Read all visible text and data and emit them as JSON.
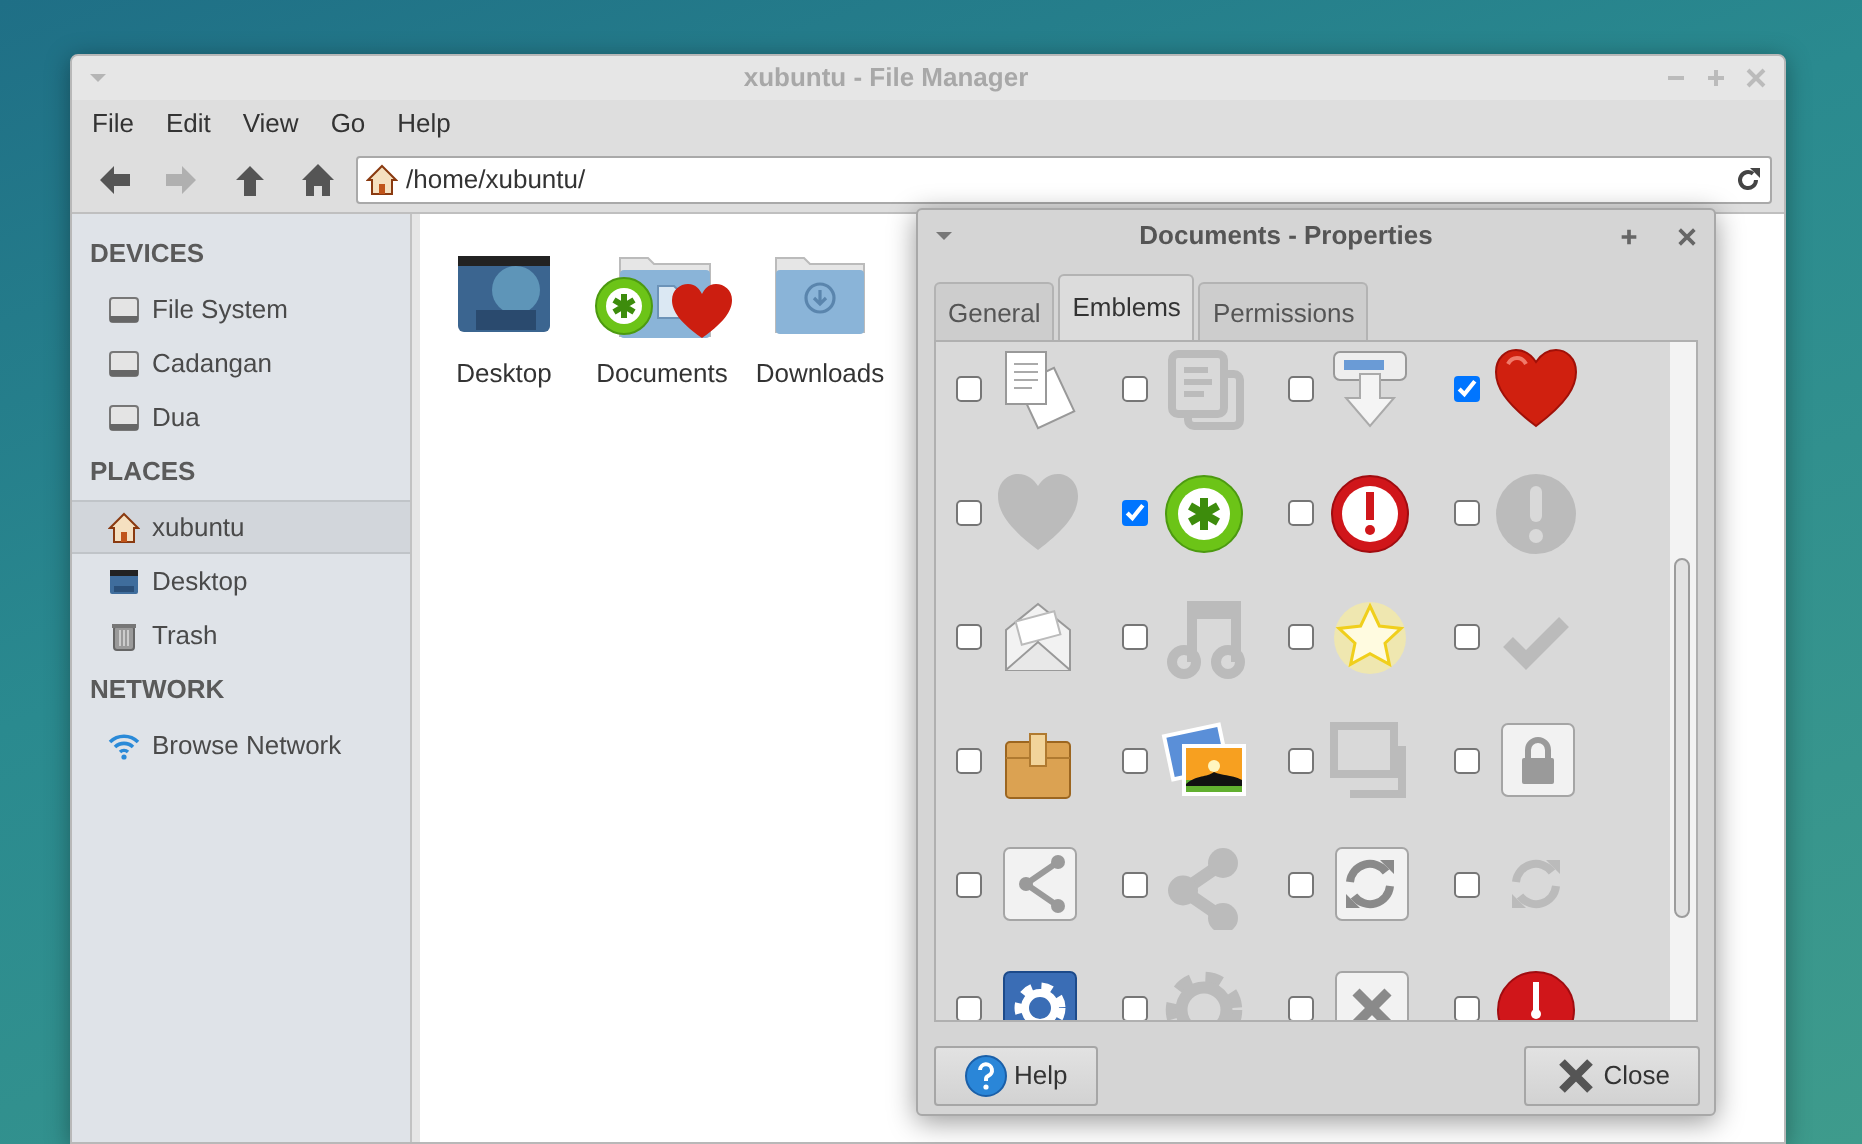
{
  "window": {
    "title": "xubuntu - File Manager"
  },
  "menu": [
    "File",
    "Edit",
    "View",
    "Go",
    "Help"
  ],
  "toolbar": [
    {
      "kind": "back",
      "disabled": false
    },
    {
      "kind": "forward",
      "disabled": true
    },
    {
      "kind": "up",
      "disabled": false
    },
    {
      "kind": "home",
      "disabled": false
    }
  ],
  "location": {
    "value": "/home/xubuntu/"
  },
  "sidebar": {
    "sections": [
      {
        "heading": "DEVICES",
        "items": [
          {
            "label": "File System",
            "kind": "drive",
            "selected": false
          },
          {
            "label": "Cadangan",
            "kind": "drive",
            "selected": false
          },
          {
            "label": "Dua",
            "kind": "drive",
            "selected": false
          }
        ]
      },
      {
        "heading": "PLACES",
        "items": [
          {
            "label": "xubuntu",
            "kind": "home",
            "selected": true
          },
          {
            "label": "Desktop",
            "kind": "desktop",
            "selected": false
          },
          {
            "label": "Trash",
            "kind": "trash",
            "selected": false
          }
        ]
      },
      {
        "heading": "NETWORK",
        "items": [
          {
            "label": "Browse Network",
            "kind": "network",
            "selected": false
          }
        ]
      }
    ]
  },
  "files": [
    {
      "label": "Desktop",
      "kind": "desktop"
    },
    {
      "label": "Documents",
      "kind": "emblem-folder"
    },
    {
      "label": "Downloads",
      "kind": "downloads"
    }
  ],
  "dialog": {
    "title": "Documents - Properties",
    "tabs": [
      {
        "label": "General",
        "selected": false
      },
      {
        "label": "Emblems",
        "selected": true
      },
      {
        "label": "Permissions",
        "selected": false
      }
    ],
    "emblems": [
      {
        "checked": false
      },
      {
        "checked": false
      },
      {
        "checked": false
      },
      {
        "checked": true
      },
      {
        "checked": false
      },
      {
        "checked": true
      },
      {
        "checked": false
      },
      {
        "checked": false
      },
      {
        "checked": false
      },
      {
        "checked": false
      },
      {
        "checked": false
      },
      {
        "checked": false
      },
      {
        "checked": false
      },
      {
        "checked": false
      },
      {
        "checked": false
      },
      {
        "checked": false
      },
      {
        "checked": false
      },
      {
        "checked": false
      },
      {
        "checked": false
      },
      {
        "checked": false
      },
      {
        "checked": false
      },
      {
        "checked": false
      },
      {
        "checked": false
      },
      {
        "checked": false
      }
    ],
    "buttons": [
      {
        "label": "Help",
        "kind": "help"
      },
      {
        "label": "Close",
        "kind": "close"
      }
    ]
  }
}
